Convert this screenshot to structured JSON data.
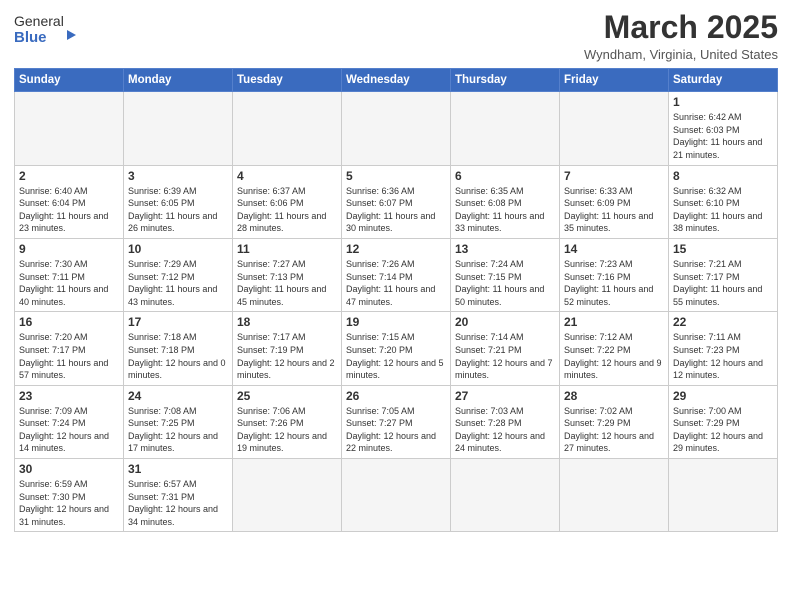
{
  "header": {
    "logo_general": "General",
    "logo_blue": "Blue",
    "month_title": "March 2025",
    "location": "Wyndham, Virginia, United States"
  },
  "weekdays": [
    "Sunday",
    "Monday",
    "Tuesday",
    "Wednesday",
    "Thursday",
    "Friday",
    "Saturday"
  ],
  "weeks": [
    [
      {
        "day": "",
        "info": ""
      },
      {
        "day": "",
        "info": ""
      },
      {
        "day": "",
        "info": ""
      },
      {
        "day": "",
        "info": ""
      },
      {
        "day": "",
        "info": ""
      },
      {
        "day": "",
        "info": ""
      },
      {
        "day": "1",
        "info": "Sunrise: 6:42 AM\nSunset: 6:03 PM\nDaylight: 11 hours and 21 minutes."
      }
    ],
    [
      {
        "day": "2",
        "info": "Sunrise: 6:40 AM\nSunset: 6:04 PM\nDaylight: 11 hours and 23 minutes."
      },
      {
        "day": "3",
        "info": "Sunrise: 6:39 AM\nSunset: 6:05 PM\nDaylight: 11 hours and 26 minutes."
      },
      {
        "day": "4",
        "info": "Sunrise: 6:37 AM\nSunset: 6:06 PM\nDaylight: 11 hours and 28 minutes."
      },
      {
        "day": "5",
        "info": "Sunrise: 6:36 AM\nSunset: 6:07 PM\nDaylight: 11 hours and 30 minutes."
      },
      {
        "day": "6",
        "info": "Sunrise: 6:35 AM\nSunset: 6:08 PM\nDaylight: 11 hours and 33 minutes."
      },
      {
        "day": "7",
        "info": "Sunrise: 6:33 AM\nSunset: 6:09 PM\nDaylight: 11 hours and 35 minutes."
      },
      {
        "day": "8",
        "info": "Sunrise: 6:32 AM\nSunset: 6:10 PM\nDaylight: 11 hours and 38 minutes."
      }
    ],
    [
      {
        "day": "9",
        "info": "Sunrise: 7:30 AM\nSunset: 7:11 PM\nDaylight: 11 hours and 40 minutes."
      },
      {
        "day": "10",
        "info": "Sunrise: 7:29 AM\nSunset: 7:12 PM\nDaylight: 11 hours and 43 minutes."
      },
      {
        "day": "11",
        "info": "Sunrise: 7:27 AM\nSunset: 7:13 PM\nDaylight: 11 hours and 45 minutes."
      },
      {
        "day": "12",
        "info": "Sunrise: 7:26 AM\nSunset: 7:14 PM\nDaylight: 11 hours and 47 minutes."
      },
      {
        "day": "13",
        "info": "Sunrise: 7:24 AM\nSunset: 7:15 PM\nDaylight: 11 hours and 50 minutes."
      },
      {
        "day": "14",
        "info": "Sunrise: 7:23 AM\nSunset: 7:16 PM\nDaylight: 11 hours and 52 minutes."
      },
      {
        "day": "15",
        "info": "Sunrise: 7:21 AM\nSunset: 7:17 PM\nDaylight: 11 hours and 55 minutes."
      }
    ],
    [
      {
        "day": "16",
        "info": "Sunrise: 7:20 AM\nSunset: 7:17 PM\nDaylight: 11 hours and 57 minutes."
      },
      {
        "day": "17",
        "info": "Sunrise: 7:18 AM\nSunset: 7:18 PM\nDaylight: 12 hours and 0 minutes."
      },
      {
        "day": "18",
        "info": "Sunrise: 7:17 AM\nSunset: 7:19 PM\nDaylight: 12 hours and 2 minutes."
      },
      {
        "day": "19",
        "info": "Sunrise: 7:15 AM\nSunset: 7:20 PM\nDaylight: 12 hours and 5 minutes."
      },
      {
        "day": "20",
        "info": "Sunrise: 7:14 AM\nSunset: 7:21 PM\nDaylight: 12 hours and 7 minutes."
      },
      {
        "day": "21",
        "info": "Sunrise: 7:12 AM\nSunset: 7:22 PM\nDaylight: 12 hours and 9 minutes."
      },
      {
        "day": "22",
        "info": "Sunrise: 7:11 AM\nSunset: 7:23 PM\nDaylight: 12 hours and 12 minutes."
      }
    ],
    [
      {
        "day": "23",
        "info": "Sunrise: 7:09 AM\nSunset: 7:24 PM\nDaylight: 12 hours and 14 minutes."
      },
      {
        "day": "24",
        "info": "Sunrise: 7:08 AM\nSunset: 7:25 PM\nDaylight: 12 hours and 17 minutes."
      },
      {
        "day": "25",
        "info": "Sunrise: 7:06 AM\nSunset: 7:26 PM\nDaylight: 12 hours and 19 minutes."
      },
      {
        "day": "26",
        "info": "Sunrise: 7:05 AM\nSunset: 7:27 PM\nDaylight: 12 hours and 22 minutes."
      },
      {
        "day": "27",
        "info": "Sunrise: 7:03 AM\nSunset: 7:28 PM\nDaylight: 12 hours and 24 minutes."
      },
      {
        "day": "28",
        "info": "Sunrise: 7:02 AM\nSunset: 7:29 PM\nDaylight: 12 hours and 27 minutes."
      },
      {
        "day": "29",
        "info": "Sunrise: 7:00 AM\nSunset: 7:29 PM\nDaylight: 12 hours and 29 minutes."
      }
    ],
    [
      {
        "day": "30",
        "info": "Sunrise: 6:59 AM\nSunset: 7:30 PM\nDaylight: 12 hours and 31 minutes."
      },
      {
        "day": "31",
        "info": "Sunrise: 6:57 AM\nSunset: 7:31 PM\nDaylight: 12 hours and 34 minutes."
      },
      {
        "day": "",
        "info": ""
      },
      {
        "day": "",
        "info": ""
      },
      {
        "day": "",
        "info": ""
      },
      {
        "day": "",
        "info": ""
      },
      {
        "day": "",
        "info": ""
      }
    ]
  ]
}
